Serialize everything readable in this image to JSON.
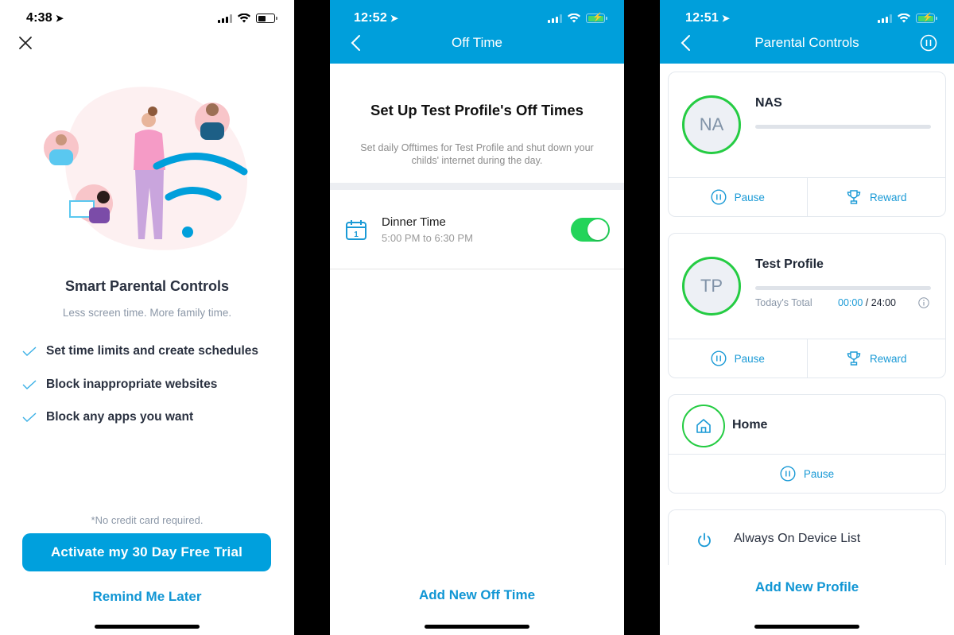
{
  "screens": [
    {
      "status": {
        "time": "4:38",
        "battery_pct": 55
      },
      "close_icon": "close-icon",
      "title": "Smart Parental Controls",
      "subtitle": "Less screen time. More family time.",
      "features": [
        "Set time limits and create schedules",
        "Block inappropriate websites",
        "Block any apps you want"
      ],
      "note": "*No credit card required.",
      "primary_button": "Activate my 30 Day Free Trial",
      "secondary_button": "Remind Me Later"
    },
    {
      "status": {
        "time": "12:52",
        "charging": true
      },
      "nav_title": "Off Time",
      "heading": "Set Up Test Profile's Off Times",
      "description": "Set daily Offtimes for Test Profile and shut down your childs' internet during the day.",
      "off_times": [
        {
          "name": "Dinner Time",
          "range": "5:00 PM to 6:30 PM",
          "enabled": true,
          "calendar_day": "1"
        }
      ],
      "add_button": "Add New Off Time"
    },
    {
      "status": {
        "time": "12:51",
        "charging": true
      },
      "nav_title": "Parental Controls",
      "profiles": [
        {
          "initials": "NA",
          "name": "NAS",
          "usage_fraction": 0,
          "actions": [
            "Pause",
            "Reward"
          ]
        },
        {
          "initials": "TP",
          "name": "Test Profile",
          "usage_fraction": 0,
          "today_label": "Today's Total",
          "used": "00:00",
          "limit": "/ 24:00",
          "actions": [
            "Pause",
            "Reward"
          ]
        }
      ],
      "home": {
        "name": "Home",
        "action": "Pause"
      },
      "always_on": "Always On Device List",
      "add_button": "Add New Profile"
    }
  ],
  "colors": {
    "brand_blue": "#009fdb",
    "link_blue": "#1196d4",
    "active_green": "#25cc43",
    "toggle_green": "#23d45a"
  }
}
